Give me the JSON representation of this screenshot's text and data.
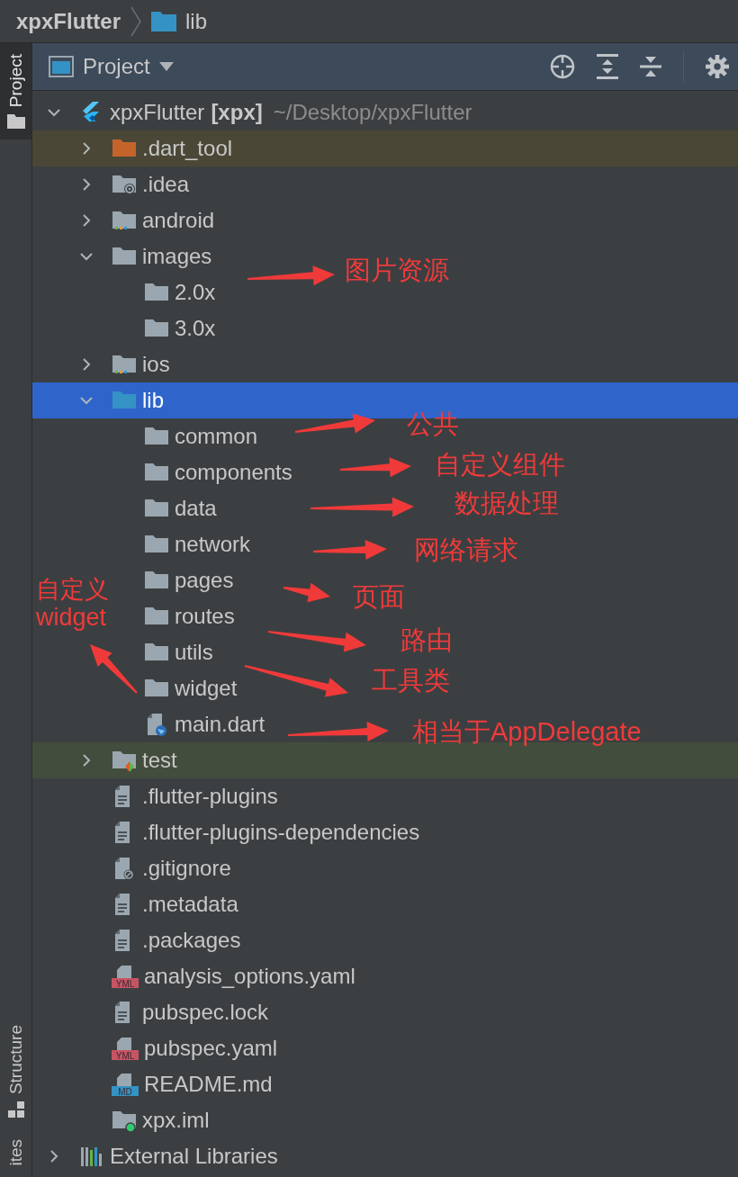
{
  "breadcrumb": [
    {
      "label": "xpxFlutter",
      "kind": "project"
    },
    {
      "label": "lib",
      "kind": "folder"
    }
  ],
  "side_tabs": [
    {
      "label": "Project",
      "kind": "project",
      "selected": true
    },
    {
      "label": "Structure",
      "kind": "structure",
      "selected": false
    },
    {
      "label": "ites",
      "kind": "favorites",
      "selected": false
    }
  ],
  "panel": {
    "title": "Project"
  },
  "tree": [
    {
      "label": "xpxFlutter",
      "module": "[xpx]",
      "path": "~/Desktop/xpxFlutter",
      "kind": "flutter-project",
      "expanded": true,
      "selected": false,
      "children": [
        {
          "label": ".dart_tool",
          "kind": "excluded-folder",
          "expanded": false,
          "selected": false,
          "color": "#4a4736"
        },
        {
          "label": ".idea",
          "kind": "settings-folder",
          "expanded": false,
          "selected": false
        },
        {
          "label": "android",
          "kind": "module-folder",
          "expanded": false,
          "selected": false
        },
        {
          "label": "images",
          "kind": "folder",
          "expanded": true,
          "selected": false,
          "children": [
            {
              "label": "2.0x",
              "kind": "folder",
              "selected": false
            },
            {
              "label": "3.0x",
              "kind": "folder",
              "selected": false
            }
          ]
        },
        {
          "label": "ios",
          "kind": "module-folder",
          "expanded": false,
          "selected": false
        },
        {
          "label": "lib",
          "kind": "source-folder",
          "expanded": true,
          "selected": true,
          "children": [
            {
              "label": "common",
              "kind": "folder",
              "selected": false
            },
            {
              "label": "components",
              "kind": "folder",
              "selected": false
            },
            {
              "label": "data",
              "kind": "folder",
              "selected": false
            },
            {
              "label": "network",
              "kind": "folder",
              "selected": false
            },
            {
              "label": "pages",
              "kind": "folder",
              "selected": false
            },
            {
              "label": "routes",
              "kind": "folder",
              "selected": false
            },
            {
              "label": "utils",
              "kind": "folder",
              "selected": false
            },
            {
              "label": "widget",
              "kind": "folder",
              "selected": false
            },
            {
              "label": "main.dart",
              "kind": "dart-file",
              "selected": false
            }
          ]
        },
        {
          "label": "test",
          "kind": "test-folder",
          "expanded": false,
          "selected": false,
          "color": "#434d3d"
        },
        {
          "label": ".flutter-plugins",
          "kind": "text-file",
          "selected": false
        },
        {
          "label": ".flutter-plugins-dependencies",
          "kind": "text-file",
          "selected": false
        },
        {
          "label": ".gitignore",
          "kind": "ignore-file",
          "selected": false
        },
        {
          "label": ".metadata",
          "kind": "text-file",
          "selected": false
        },
        {
          "label": ".packages",
          "kind": "text-file",
          "selected": false
        },
        {
          "label": "analysis_options.yaml",
          "kind": "badge-file",
          "badge": "YML",
          "selected": false
        },
        {
          "label": "pubspec.lock",
          "kind": "text-file",
          "selected": false
        },
        {
          "label": "pubspec.yaml",
          "kind": "badge-file",
          "badge": "YML",
          "selected": false
        },
        {
          "label": "README.md",
          "kind": "badge-file",
          "badge": "MD",
          "selected": false
        },
        {
          "label": "xpx.iml",
          "kind": "module-file",
          "selected": false
        }
      ]
    },
    {
      "label": "External Libraries",
      "kind": "libraries",
      "expanded": false,
      "selected": false
    }
  ],
  "annotations": [
    {
      "text": "图片资源"
    },
    {
      "text": "公共"
    },
    {
      "text": "自定义组件"
    },
    {
      "text": "数据处理"
    },
    {
      "text": "网络请求"
    },
    {
      "text": "页面"
    },
    {
      "text": "自定义widget"
    },
    {
      "text": "路由"
    },
    {
      "text": "工具类"
    },
    {
      "text": "相当于AppDelegate"
    }
  ]
}
